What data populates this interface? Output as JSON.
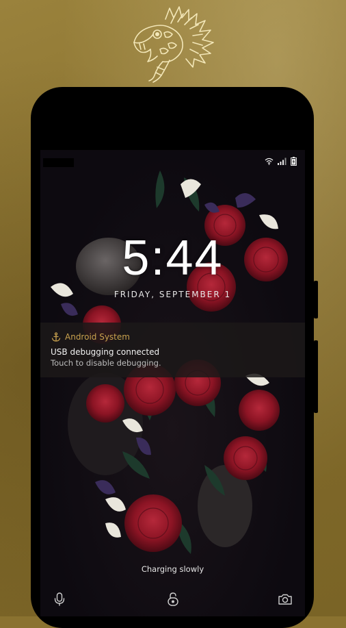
{
  "lockscreen": {
    "time": "5:44",
    "date": "FRIDAY, SEPTEMBER 1",
    "charging_status": "Charging slowly"
  },
  "notification": {
    "app_name": "Android System",
    "title": "USB debugging connected",
    "text": "Touch to disable debugging."
  },
  "status_bar": {
    "icons": [
      "wifi-icon",
      "signal-icon",
      "battery-charging-icon"
    ]
  },
  "bottom_actions": {
    "icons": [
      "voice-assist-icon",
      "unlock-icon",
      "camera-icon"
    ]
  },
  "colors": {
    "background": "#8a7230",
    "notification_accent": "#c9a24e"
  }
}
